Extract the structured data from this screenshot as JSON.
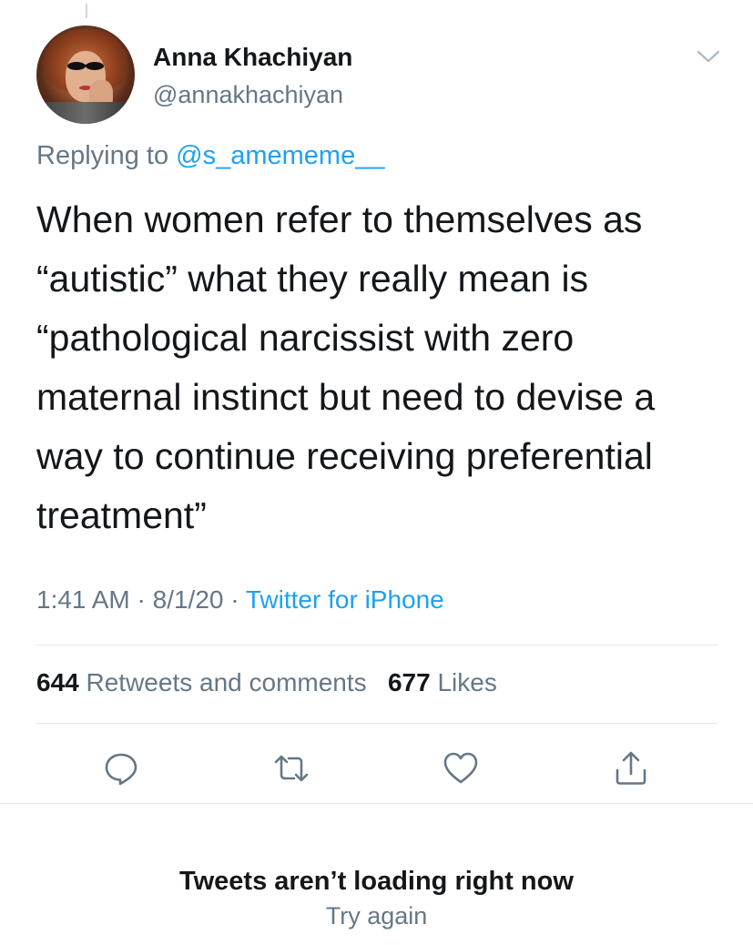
{
  "tweet": {
    "author_name": "Anna Khachiyan",
    "author_handle": "@annakhachiyan",
    "reply_prefix": "Replying to",
    "reply_mention": "@s_amememe__",
    "text": "When women refer to themselves as “autistic” what they really mean is “pathological narcissist with zero maternal instinct but need to devise a way to continue receiving preferential treatment”",
    "time": "1:41 AM",
    "date": "8/1/20",
    "source": "Twitter for iPhone",
    "separator": "·",
    "retweets_count": "644",
    "retweets_label": "Retweets and comments",
    "likes_count": "677",
    "likes_label": "Likes"
  },
  "actions": {
    "reply": "reply-icon",
    "retweet": "retweet-icon",
    "like": "heart-icon",
    "share": "share-icon"
  },
  "footer": {
    "error_title": "Tweets aren’t loading right now",
    "retry_label": "Try again"
  },
  "colors": {
    "accent": "#1da1f2",
    "secondary_text": "#657786",
    "primary_text": "#14171a",
    "divider": "#e1e8ed"
  }
}
